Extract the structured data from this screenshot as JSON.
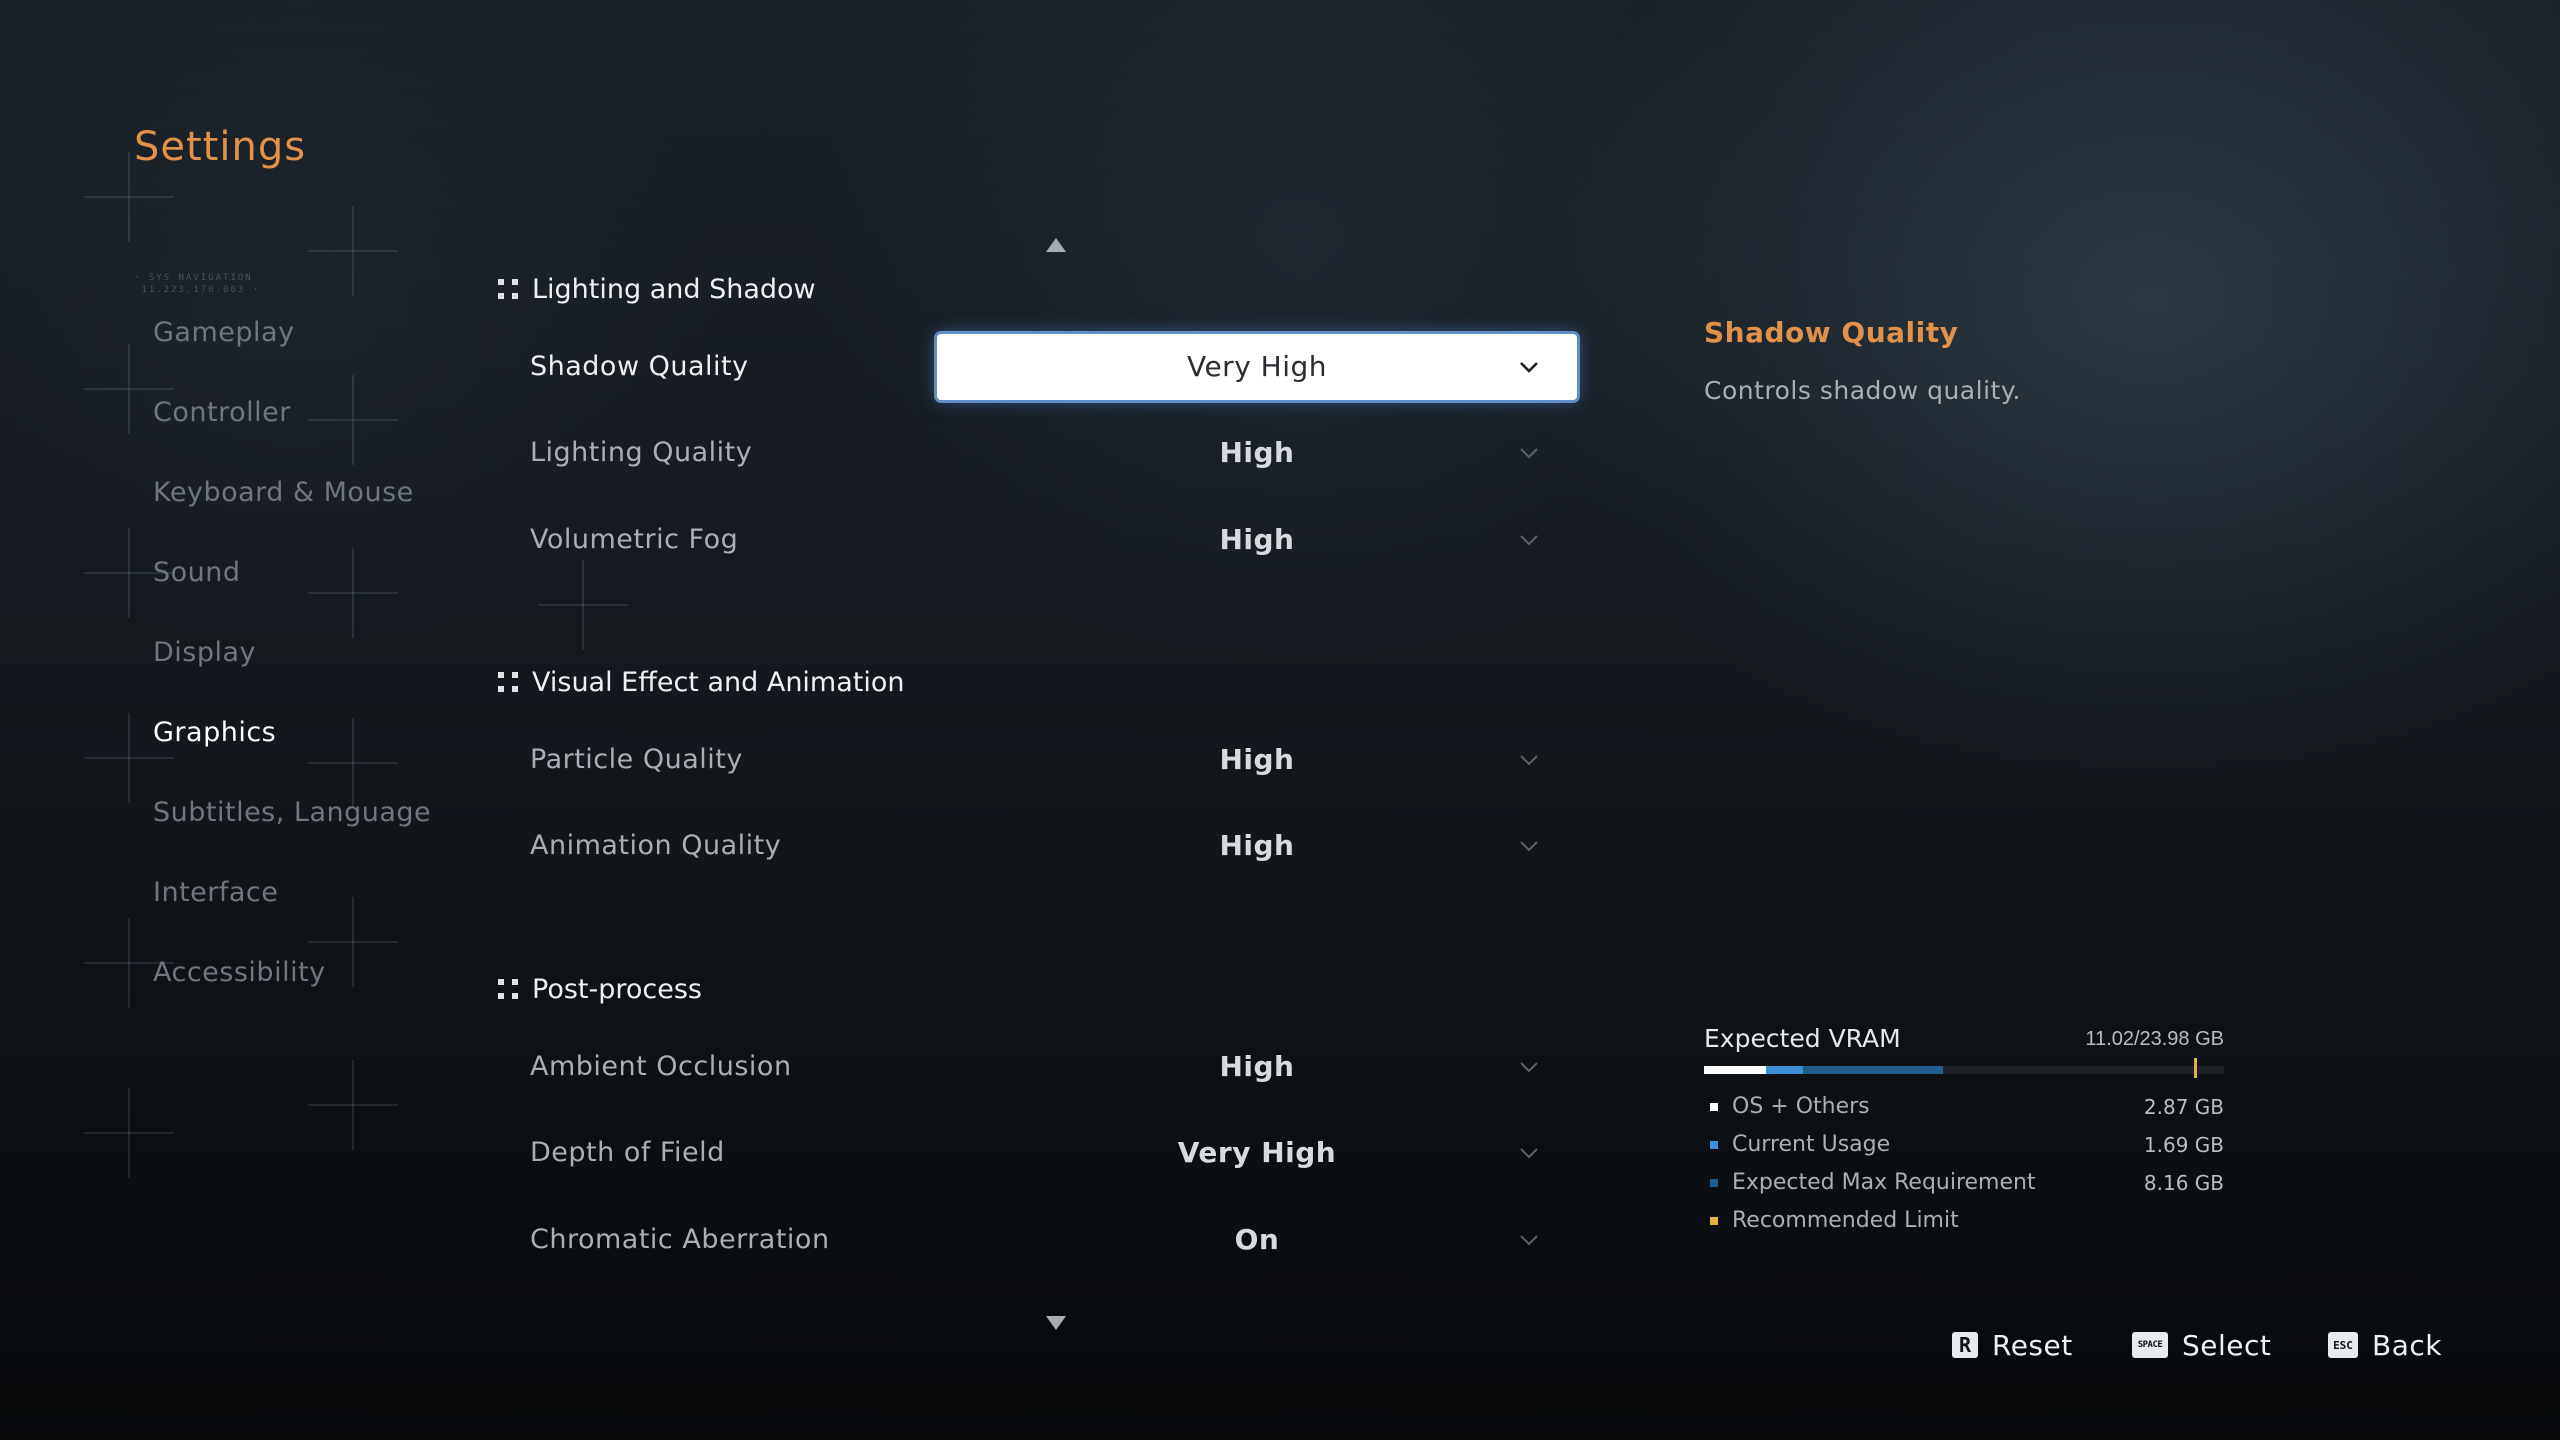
{
  "page": {
    "title": "Settings",
    "nav_tag": "· SYS NAVIGATION\n 11.223.170.063 ·"
  },
  "sidebar": {
    "items": [
      {
        "label": "Gameplay",
        "active": false
      },
      {
        "label": "Controller",
        "active": false
      },
      {
        "label": "Keyboard & Mouse",
        "active": false
      },
      {
        "label": "Sound",
        "active": false
      },
      {
        "label": "Display",
        "active": false
      },
      {
        "label": "Graphics",
        "active": true
      },
      {
        "label": "Subtitles, Language",
        "active": false
      },
      {
        "label": "Interface",
        "active": false
      },
      {
        "label": "Accessibility",
        "active": false
      }
    ]
  },
  "sections": [
    {
      "title": "Lighting and Shadow",
      "settings": [
        {
          "label": "Shadow Quality",
          "value": "Very High",
          "focused": true
        },
        {
          "label": "Lighting Quality",
          "value": "High"
        },
        {
          "label": "Volumetric Fog",
          "value": "High"
        }
      ]
    },
    {
      "title": "Visual Effect and Animation",
      "settings": [
        {
          "label": "Particle Quality",
          "value": "High"
        },
        {
          "label": "Animation Quality",
          "value": "High"
        }
      ]
    },
    {
      "title": "Post-process",
      "settings": [
        {
          "label": "Ambient Occlusion",
          "value": "High"
        },
        {
          "label": "Depth of Field",
          "value": "Very High"
        },
        {
          "label": "Chromatic Aberration",
          "value": "On"
        }
      ]
    }
  ],
  "info": {
    "title": "Shadow Quality",
    "description": "Controls shadow quality."
  },
  "vram": {
    "title": "Expected VRAM",
    "total_text": "11.02/23.98 GB",
    "capacity_gb": 23.98,
    "recommended_limit_gb": 22.6,
    "legend": [
      {
        "label": "OS + Others",
        "value": "2.87 GB",
        "gb": 2.87,
        "color": "#ffffff"
      },
      {
        "label": "Current Usage",
        "value": "1.69 GB",
        "gb": 1.69,
        "color": "#3d8fd6"
      },
      {
        "label": "Expected Max Requirement",
        "value": "8.16 GB",
        "gb": 8.16,
        "color": "#1f5d8c"
      },
      {
        "label": "Recommended Limit",
        "value": "",
        "color": "#e3b341"
      }
    ]
  },
  "footer": {
    "buttons": [
      {
        "key": "R",
        "label": "Reset"
      },
      {
        "key": "SPACE",
        "label": "Select"
      },
      {
        "key": "ESC",
        "label": "Back"
      }
    ]
  },
  "colors": {
    "accent": "#e0914a",
    "focus_glow": "#78aaeb",
    "limit": "#e3b341"
  }
}
